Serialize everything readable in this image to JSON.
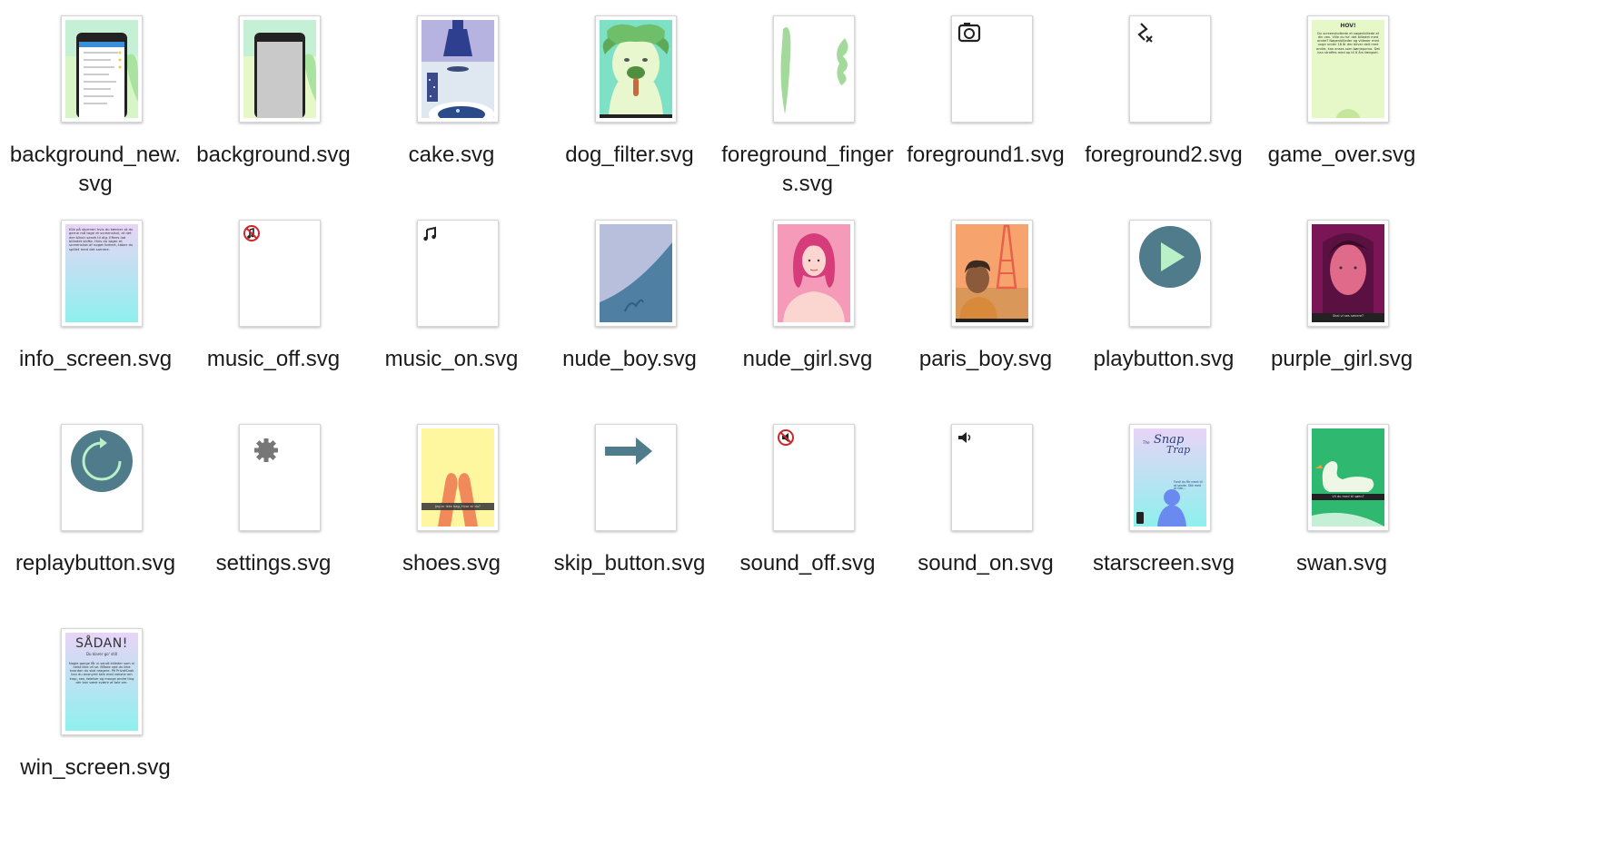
{
  "window": {
    "view": "icon-grid"
  },
  "files": [
    {
      "name": "background_new.svg",
      "label_lines": [
        "background_new.",
        "svg"
      ],
      "art": "background_new"
    },
    {
      "name": "background.svg",
      "label_lines": [
        "background.svg"
      ],
      "art": "background"
    },
    {
      "name": "cake.svg",
      "label_lines": [
        "cake.svg"
      ],
      "art": "cake"
    },
    {
      "name": "dog_filter.svg",
      "label_lines": [
        "dog_filter.svg"
      ],
      "art": "dog_filter"
    },
    {
      "name": "foreground_fingers.svg",
      "label_lines": [
        "foreground_finger",
        "s.svg"
      ],
      "art": "foreground_fingers"
    },
    {
      "name": "foreground1.svg",
      "label_lines": [
        "foreground1.svg"
      ],
      "art": "foreground1"
    },
    {
      "name": "foreground2.svg",
      "label_lines": [
        "foreground2.svg"
      ],
      "art": "foreground2"
    },
    {
      "name": "game_over.svg",
      "label_lines": [
        "game_over.svg"
      ],
      "art": "game_over"
    },
    {
      "name": "info_screen.svg",
      "label_lines": [
        "info_screen.svg"
      ],
      "art": "info_screen"
    },
    {
      "name": "music_off.svg",
      "label_lines": [
        "music_off.svg"
      ],
      "art": "music_off"
    },
    {
      "name": "music_on.svg",
      "label_lines": [
        "music_on.svg"
      ],
      "art": "music_on"
    },
    {
      "name": "nude_boy.svg",
      "label_lines": [
        "nude_boy.svg"
      ],
      "art": "nude_boy"
    },
    {
      "name": "nude_girl.svg",
      "label_lines": [
        "nude_girl.svg"
      ],
      "art": "nude_girl"
    },
    {
      "name": "paris_boy.svg",
      "label_lines": [
        "paris_boy.svg"
      ],
      "art": "paris_boy"
    },
    {
      "name": "playbutton.svg",
      "label_lines": [
        "playbutton.svg"
      ],
      "art": "playbutton"
    },
    {
      "name": "purple_girl.svg",
      "label_lines": [
        "purple_girl.svg"
      ],
      "art": "purple_girl"
    },
    {
      "name": "replaybutton.svg",
      "label_lines": [
        "replaybutton.svg"
      ],
      "art": "replaybutton"
    },
    {
      "name": "settings.svg",
      "label_lines": [
        "settings.svg"
      ],
      "art": "settings"
    },
    {
      "name": "shoes.svg",
      "label_lines": [
        "shoes.svg"
      ],
      "art": "shoes"
    },
    {
      "name": "skip_button.svg",
      "label_lines": [
        "skip_button.svg"
      ],
      "art": "skip_button"
    },
    {
      "name": "sound_off.svg",
      "label_lines": [
        "sound_off.svg"
      ],
      "art": "sound_off"
    },
    {
      "name": "sound_on.svg",
      "label_lines": [
        "sound_on.svg"
      ],
      "art": "sound_on"
    },
    {
      "name": "starscreen.svg",
      "label_lines": [
        "starscreen.svg"
      ],
      "art": "starscreen"
    },
    {
      "name": "swan.svg",
      "label_lines": [
        "swan.svg"
      ],
      "art": "swan"
    },
    {
      "name": "win_screen.svg",
      "label_lines": [
        "win_screen.svg"
      ],
      "art": "win_screen"
    }
  ],
  "thumb_text": {
    "game_over_title": "HOV!",
    "game_over_body": "Du screenshottede et nøgenbillede af din ven. Ville du ha' det billedet med andre? Nøgenbilleder og videoer med unge under 18 år der bliver delt med andre, kan anses som børneporno. Det kan straffes med op til 6 års fængsel.",
    "info_body": "Klik på stormen hvis du tænker at du gerne må tage et screenshot, af det der bliver sendt til dig. Efters lad billedet skifte. Hvis du tager et screenshot af noget forkert, taber du spillet med det samme.",
    "purple_caption": "Skal vi ses senere?",
    "shoes_caption": "Jeg er ikke bag, Hvor er du?",
    "star_title_small": "The",
    "star_title_1": "Snap",
    "star_title_2": "Trap",
    "star_body": "Fordi du får nemt til at sende. Stik med at lide...",
    "swan_caption": "Vil du med til søen?",
    "win_title": "SÅDAN!",
    "win_subtitle": "Du klarer go' still",
    "win_body": "Nogle gange får vi sendt billeder som vi helst ikke vil se. Måske ved du ikke hvordan du skal reagere. På PrivatSnak kan du anonymt tale med voksne om krop, sex, følelser og mange andre ting der kan være svære at tale om."
  },
  "colors": {
    "accent_teal": "#4f7b8a",
    "play_green": "#b9f0c8",
    "dog_green": "#6fbf6a",
    "pink": "#f07fb0",
    "purple_bg": "#7a1656"
  }
}
